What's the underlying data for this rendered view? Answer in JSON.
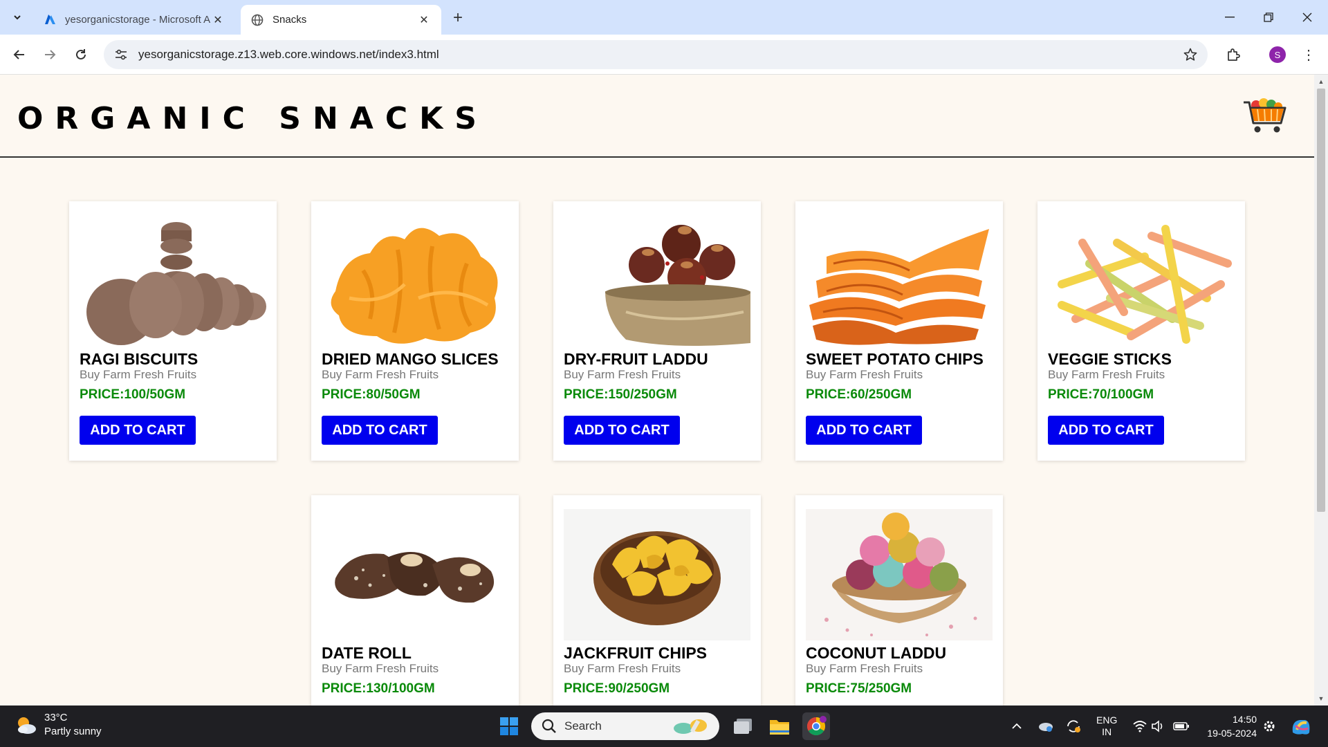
{
  "browser": {
    "tabs": [
      {
        "title": "yesorganicstorage - Microsoft Azure",
        "active": false,
        "icon": "azure-icon"
      },
      {
        "title": "Snacks",
        "active": true,
        "icon": "globe-icon"
      }
    ],
    "url": "yesorganicstorage.z13.web.core.windows.net/index3.html",
    "profile_initial": "S"
  },
  "page": {
    "title": "ORGANIC SNACKS",
    "button_label": "ADD TO CART",
    "products": [
      {
        "name": "RAGI BISCUITS",
        "subtitle": "Buy Farm Fresh Fruits",
        "price": "PRICE:100/50GM"
      },
      {
        "name": "DRIED MANGO SLICES",
        "subtitle": "Buy Farm Fresh Fruits",
        "price": "PRICE:80/50GM"
      },
      {
        "name": "DRY-FRUIT LADDU",
        "subtitle": "Buy Farm Fresh Fruits",
        "price": "PRICE:150/250GM"
      },
      {
        "name": "SWEET POTATO CHIPS",
        "subtitle": "Buy Farm Fresh Fruits",
        "price": "PRICE:60/250GM"
      },
      {
        "name": "VEGGIE STICKS",
        "subtitle": "Buy Farm Fresh Fruits",
        "price": "PRICE:70/100GM"
      },
      {
        "name": "DATE ROLL",
        "subtitle": "Buy Farm Fresh Fruits",
        "price": "PRICE:130/100GM"
      },
      {
        "name": "JACKFRUIT CHIPS",
        "subtitle": "Buy Farm Fresh Fruits",
        "price": "PRICE:90/250GM"
      },
      {
        "name": "COCONUT LADDU",
        "subtitle": "Buy Farm Fresh Fruits",
        "price": "PRICE:75/250GM"
      }
    ]
  },
  "taskbar": {
    "weather_temp": "33°C",
    "weather_desc": "Partly sunny",
    "search_placeholder": "Search",
    "lang_line1": "ENG",
    "lang_line2": "IN",
    "time": "14:50",
    "date": "19-05-2024"
  },
  "colors": {
    "button": "#0000ee",
    "price": "#0a8a0a",
    "page_bg": "#fdf8f1",
    "tabbar_bg": "#d3e3fd"
  }
}
